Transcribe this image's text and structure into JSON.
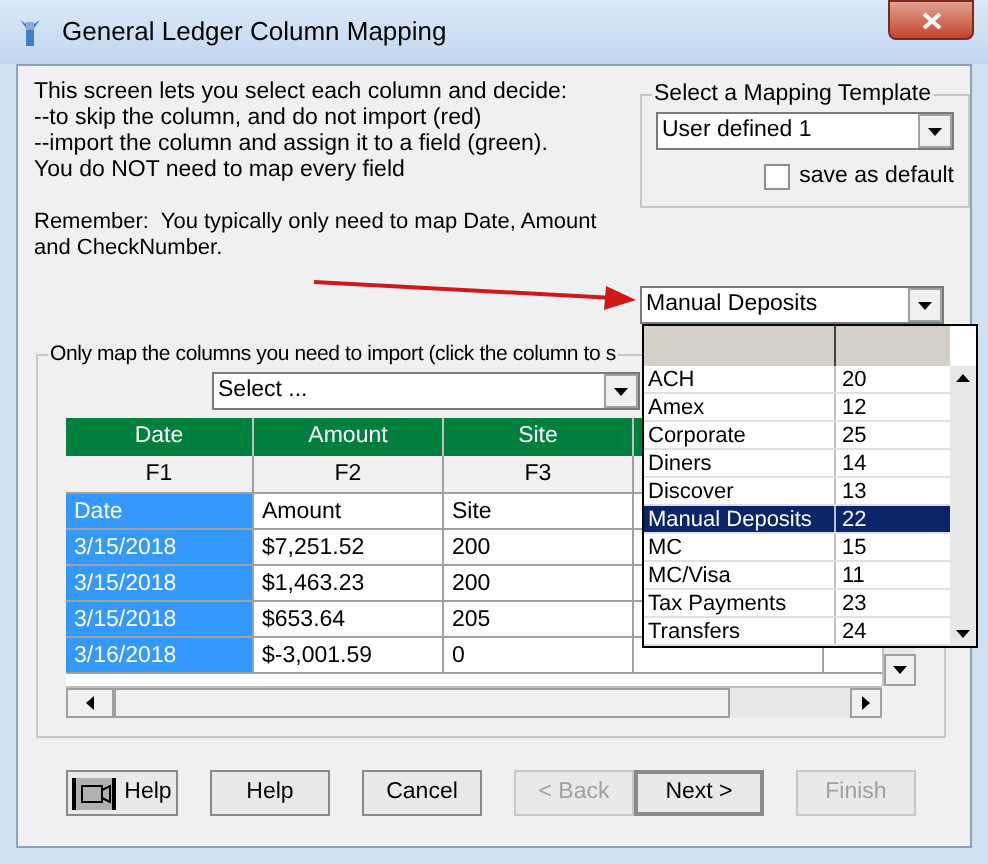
{
  "window": {
    "title": "General Ledger Column Mapping"
  },
  "intro": [
    "This screen lets you select each column and decide:",
    "--to skip the column, and do not import (red)",
    "--import the column and assign it to a field (green).",
    "You do NOT need to map every field"
  ],
  "reminder": "Remember:  You typically only need to map Date, Amount and CheckNumber.",
  "template_group": {
    "title": "Select a Mapping Template",
    "value": "User defined 1",
    "save_default": {
      "label": "save as default",
      "checked": false
    }
  },
  "account_combo": {
    "value": "Manual Deposits",
    "list": [
      {
        "name": "ACH",
        "number": "20",
        "selected": false
      },
      {
        "name": "Amex",
        "number": "12",
        "selected": false
      },
      {
        "name": "Corporate",
        "number": "25",
        "selected": false
      },
      {
        "name": "Diners",
        "number": "14",
        "selected": false
      },
      {
        "name": "Discover",
        "number": "13",
        "selected": false
      },
      {
        "name": "Manual Deposits",
        "number": "22",
        "selected": true
      },
      {
        "name": "MC",
        "number": "15",
        "selected": false
      },
      {
        "name": "MC/Visa",
        "number": "11",
        "selected": false
      },
      {
        "name": "Tax Payments",
        "number": "23",
        "selected": false
      },
      {
        "name": "Transfers",
        "number": "24",
        "selected": false
      }
    ]
  },
  "columns_group": {
    "title": "Only map the columns you need to import (click the column to s",
    "field_select": {
      "value": "Select ..."
    },
    "grid": {
      "columns": [
        {
          "mapping": "Date",
          "field": "F1",
          "selected": true
        },
        {
          "mapping": "Amount",
          "field": "F2",
          "selected": false
        },
        {
          "mapping": "Site",
          "field": "F3",
          "selected": false
        }
      ],
      "rows": [
        [
          "Date",
          "Amount",
          "Site"
        ],
        [
          "3/15/2018",
          "$7,251.52",
          "200"
        ],
        [
          "3/15/2018",
          "$1,463.23",
          "200"
        ],
        [
          "3/15/2018",
          "$653.64",
          "205"
        ],
        [
          "3/16/2018",
          "$-3,001.59",
          "0"
        ]
      ]
    }
  },
  "buttons": [
    {
      "kind": "icon-help",
      "label": "Help",
      "disabled": false
    },
    {
      "kind": "plain",
      "label": "Help",
      "disabled": false
    },
    {
      "kind": "plain",
      "label": "Cancel",
      "disabled": false
    },
    {
      "kind": "plain",
      "label": "< Back",
      "disabled": true
    },
    {
      "kind": "default",
      "label": "Next >",
      "disabled": false
    },
    {
      "kind": "plain",
      "label": "Finish",
      "disabled": true
    }
  ]
}
